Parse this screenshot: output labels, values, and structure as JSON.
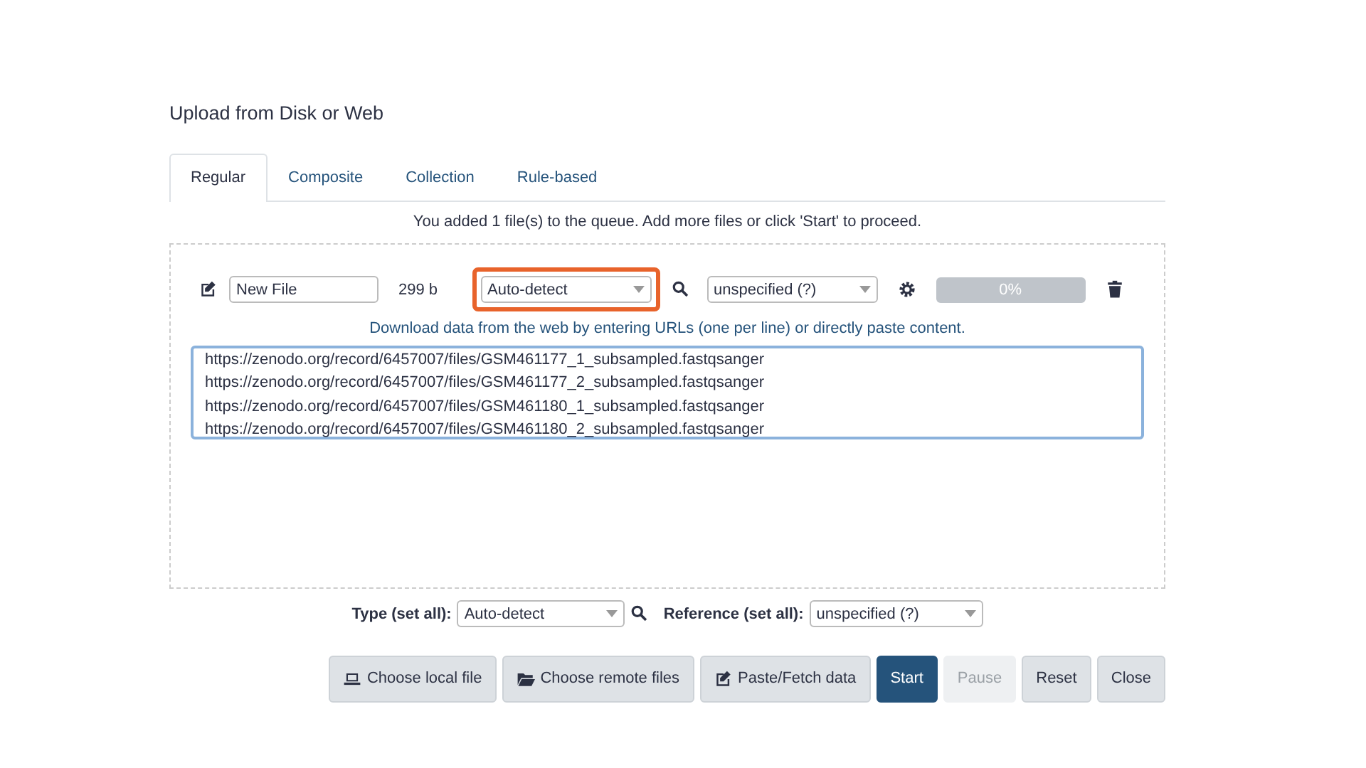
{
  "dialog": {
    "title": "Upload from Disk or Web"
  },
  "tabs": [
    {
      "label": "Regular",
      "selected": true
    },
    {
      "label": "Composite",
      "selected": false
    },
    {
      "label": "Collection",
      "selected": false
    },
    {
      "label": "Rule-based",
      "selected": false
    }
  ],
  "queue_message": "You added 1 file(s) to the queue. Add more files or click 'Start' to proceed.",
  "file_row": {
    "name": "New File",
    "size": "299 b",
    "type": {
      "value": "Auto-detect",
      "highlighted": true
    },
    "reference": "unspecified (?)",
    "progress": {
      "label": "0%",
      "level": 0
    },
    "help": "Download data from the web by entering URLs (one per line) or directly paste content.",
    "content": [
      "https://zenodo.org/record/6457007/files/GSM461177_1_subsampled.fastqsanger",
      "https://zenodo.org/record/6457007/files/GSM461177_2_subsampled.fastqsanger",
      "https://zenodo.org/record/6457007/files/GSM461180_1_subsampled.fastqsanger",
      "https://zenodo.org/record/6457007/files/GSM461180_2_subsampled.fastqsanger"
    ]
  },
  "set_all": {
    "type_label": "Type (set all):",
    "type_value": "Auto-detect",
    "reference_label": "Reference (set all):",
    "reference_value": "unspecified (?)"
  },
  "buttons": [
    {
      "label": "Choose local file",
      "kind": "laptop",
      "disabled": false,
      "primary": false
    },
    {
      "label": "Choose remote files",
      "kind": "folder",
      "disabled": false,
      "primary": false
    },
    {
      "label": "Paste/Fetch data",
      "kind": "edit",
      "disabled": false,
      "primary": false
    },
    {
      "label": "Start",
      "kind": "plain",
      "disabled": false,
      "primary": true
    },
    {
      "label": "Pause",
      "kind": "plain",
      "disabled": true,
      "primary": false
    },
    {
      "label": "Reset",
      "kind": "plain",
      "disabled": false,
      "primary": false
    },
    {
      "label": "Close",
      "kind": "plain",
      "disabled": false,
      "primary": false
    }
  ]
}
